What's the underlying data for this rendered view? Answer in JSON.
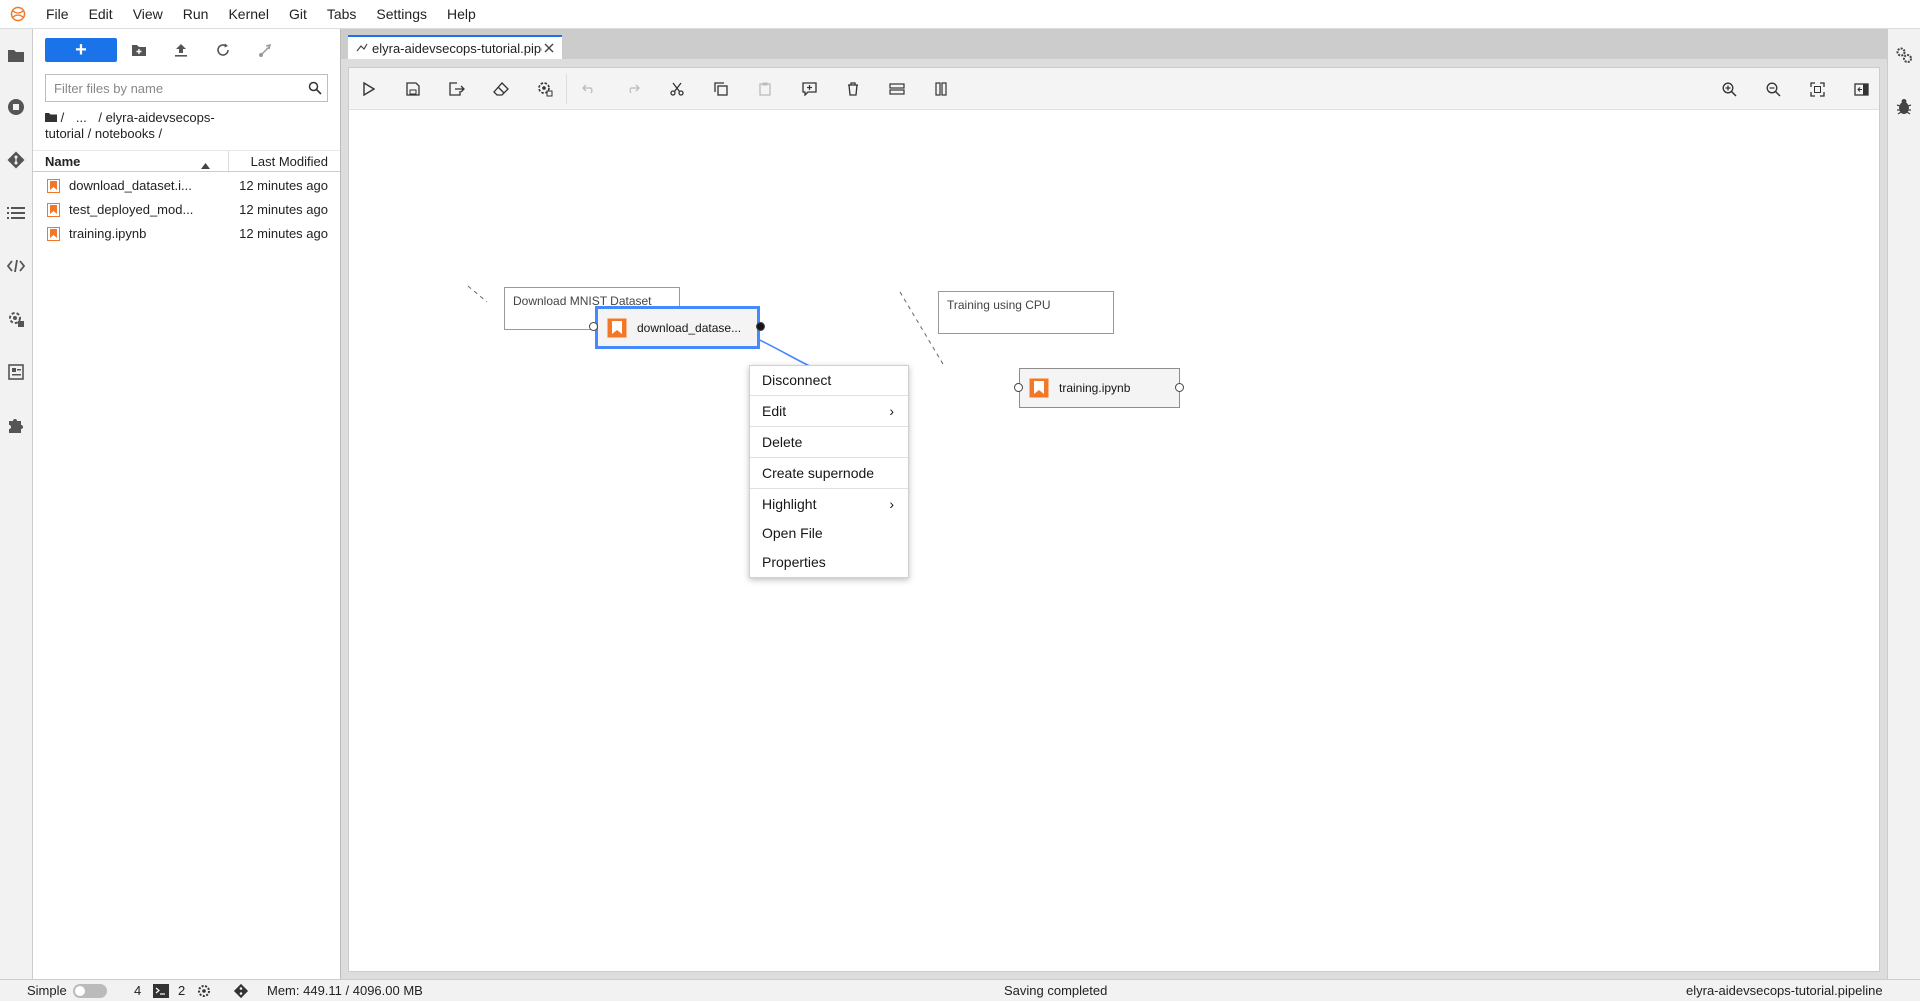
{
  "menubar": {
    "items": [
      "File",
      "Edit",
      "View",
      "Run",
      "Kernel",
      "Git",
      "Tabs",
      "Settings",
      "Help"
    ]
  },
  "filebrowser": {
    "new_label": "+",
    "filter_placeholder": "Filter files by name",
    "breadcrumb": {
      "root": "/",
      "ellipsis": "...",
      "path1": "/ elyra-aidevsecops-",
      "path2": "tutorial / notebooks /"
    },
    "columns": {
      "name": "Name",
      "modified": "Last Modified"
    },
    "files": [
      {
        "name": "download_dataset.i...",
        "modified": "12 minutes ago"
      },
      {
        "name": "test_deployed_mod...",
        "modified": "12 minutes ago"
      },
      {
        "name": "training.ipynb",
        "modified": "12 minutes ago"
      }
    ]
  },
  "main": {
    "tab_label": "elyra-aidevsecops-tutorial.pipeline"
  },
  "canvas": {
    "comments": [
      {
        "text": "Download MNIST Dataset"
      },
      {
        "text": "Training using CPU"
      }
    ],
    "nodes": [
      {
        "label": "download_datase..."
      },
      {
        "label": "training.ipynb"
      }
    ]
  },
  "context_menu": {
    "items": [
      "Disconnect",
      "Edit",
      "Delete",
      "Create supernode",
      "Highlight",
      "Open File",
      "Properties"
    ]
  },
  "statusbar": {
    "mode_label": "Simple",
    "kernels_count": "4",
    "terminals_count": "2",
    "memory": "Mem: 449.11 / 4096.00 MB",
    "status": "Saving completed",
    "filename": "elyra-aidevsecops-tutorial.pipeline"
  },
  "colors": {
    "accent": "#1a73e8",
    "notebook_icon": "#f37726",
    "selection": "#4589ff"
  }
}
